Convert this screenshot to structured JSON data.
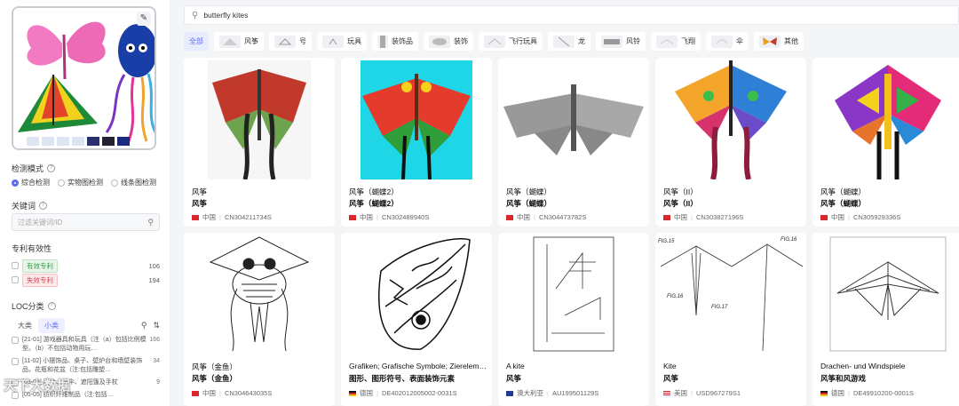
{
  "search": {
    "query": "butterfly kites"
  },
  "categories": [
    {
      "label": "全部",
      "active": true,
      "icon": ""
    },
    {
      "label": "风筝",
      "active": false,
      "icon": "kite-thumb-icon"
    },
    {
      "label": "号",
      "active": false,
      "icon": "kite-thumb-icon"
    },
    {
      "label": "玩具",
      "active": false,
      "icon": "toy-thumb-icon"
    },
    {
      "label": "装饰品",
      "active": false,
      "icon": "ornament-thumb-icon"
    },
    {
      "label": "装饰",
      "active": false,
      "icon": "decoration-thumb-icon"
    },
    {
      "label": "飞行玩具",
      "active": false,
      "icon": "flying-toy-thumb-icon"
    },
    {
      "label": "龙",
      "active": false,
      "icon": "dragon-thumb-icon"
    },
    {
      "label": "风铃",
      "active": false,
      "icon": "windchime-thumb-icon"
    },
    {
      "label": "飞翔",
      "active": false,
      "icon": "flying-thumb-icon"
    },
    {
      "label": "伞",
      "active": false,
      "icon": "umbrella-thumb-icon"
    },
    {
      "label": "其他",
      "active": false,
      "icon": "butterfly-thumb-icon"
    }
  ],
  "sidebar": {
    "detect_mode_label": "检测模式",
    "modes": [
      {
        "label": "综合检测",
        "selected": true
      },
      {
        "label": "实物图检测",
        "selected": false
      },
      {
        "label": "线条图检测",
        "selected": false
      }
    ],
    "keyword_label": "关键词",
    "keyword_placeholder": "过滤关键词/ID",
    "validity_label": "专利有效性",
    "validity": [
      {
        "label": "有效专利",
        "count": "106"
      },
      {
        "label": "失效专利",
        "count": "194"
      }
    ],
    "loc_label": "LOC分类",
    "loc_tabs": [
      "大类",
      "小类"
    ],
    "loc_items": [
      {
        "text": "[21-01] 游戏器具和玩具（注（a）包括比例模型。（b）不包括动物用玩…",
        "count": "166"
      },
      {
        "text": "[11-02] 小摆饰品、桌子、壁炉台和墙壁装饰品，花瓶和花盆（注:包括雕塑…",
        "count": "34"
      },
      {
        "text": "[03-03] 雨伞、阳伞、遮阳篷及手杖",
        "count": "9"
      },
      {
        "text": "[05-05] 纺织纤维制品（注:包括…",
        "count": ""
      }
    ],
    "watermark": "天下大数据"
  },
  "colors": {
    "accent": "#5b6cf0",
    "valid_green": "#3a9b4a",
    "invalid_red": "#d84a55"
  },
  "results": [
    {
      "t1": "风筝",
      "t2": "风筝",
      "country": "中国",
      "flag": "cn",
      "id": "CN304211734S",
      "image": "black-tail-butterfly-kite"
    },
    {
      "t1": "风筝（蝴蝶2）",
      "t2": "风筝（蝴蝶2）",
      "country": "中国",
      "flag": "cn",
      "id": "CN302489940S",
      "image": "butterfly-kite-cyan"
    },
    {
      "t1": "风筝（蝴蝶）",
      "t2": "风筝（蝴蝶）",
      "country": "中国",
      "flag": "cn",
      "id": "CN304473782S",
      "image": "grey-butterfly-3d"
    },
    {
      "t1": "风筝（II）",
      "t2": "风筝（II）",
      "country": "中国",
      "flag": "cn",
      "id": "CN303827196S",
      "image": "colorful-butterfly-kite"
    },
    {
      "t1": "风筝（蝴蝶）",
      "t2": "风筝（蝴蝶）",
      "country": "中国",
      "flag": "cn",
      "id": "CN305929336S",
      "image": "rainbow-butterfly-kite"
    },
    {
      "t1": "风筝（金鱼）",
      "t2": "风筝（金鱼）",
      "country": "中国",
      "flag": "cn",
      "id": "CN304643035S",
      "image": "goldfish-kite-line"
    },
    {
      "t1": "Grafiken; Grafische Symbole; Zierelem…",
      "t2": "图形、图形符号、表面装饰元素",
      "country": "德国",
      "flag": "de",
      "id": "DE402012005002-0031S",
      "image": "zentangle-leaf"
    },
    {
      "t1": "A kite",
      "t2": "风筝",
      "country": "澳大利亚",
      "flag": "au",
      "id": "AU199501129S",
      "image": "kite-technical-drawing"
    },
    {
      "t1": "Kite",
      "t2": "风筝",
      "country": "美国",
      "flag": "us",
      "id": "USD967279S1",
      "image": "stunt-kite-fig"
    },
    {
      "t1": "Drachen- und Windspiele",
      "t2": "风筝和风游戏",
      "country": "德国",
      "flag": "de",
      "id": "DE49910200-0001S",
      "image": "delta-kite-line"
    }
  ],
  "figure_labels": {
    "fig15": "FIG.15",
    "fig16": "FIG.16",
    "fig16b": "FIG.16",
    "fig17": "FIG.17"
  }
}
